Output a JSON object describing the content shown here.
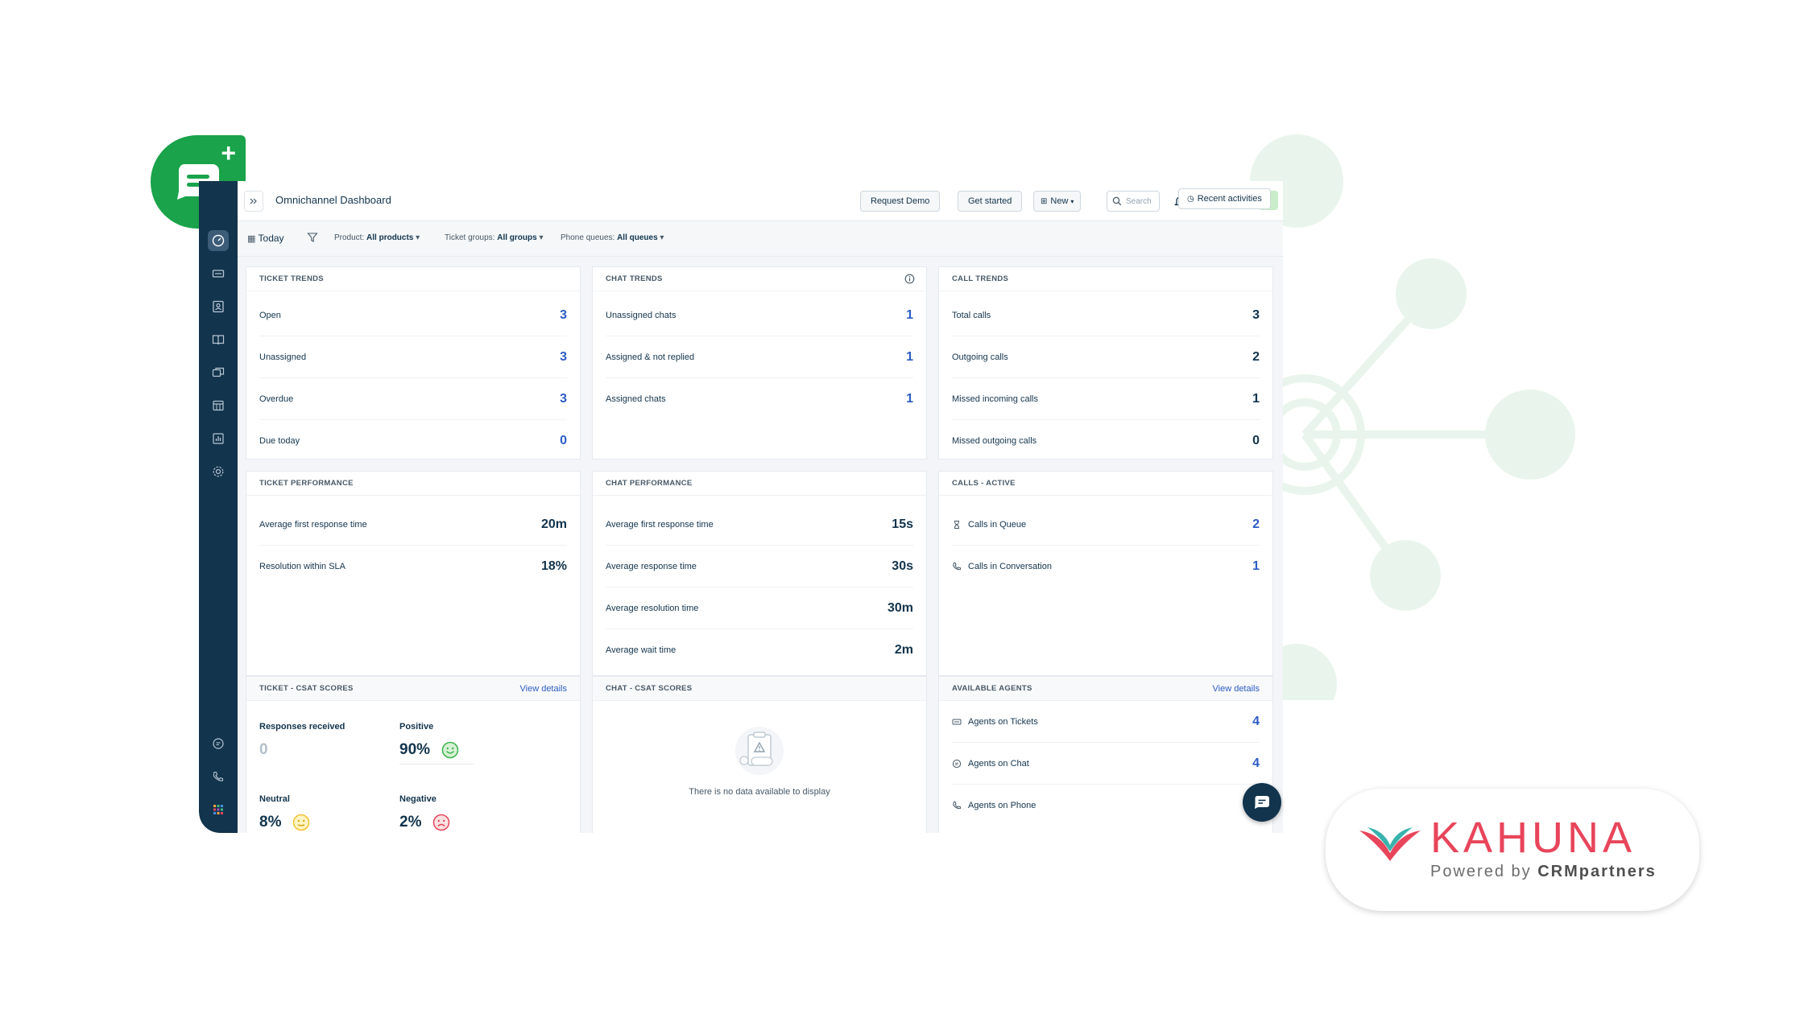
{
  "header": {
    "title": "Omnichannel Dashboard",
    "request_demo": "Request Demo",
    "get_started": "Get started",
    "new": "New",
    "search_placeholder": "Search",
    "avatar_initial": "N"
  },
  "filters": {
    "today": "Today",
    "product_label": "Product:",
    "product_value": "All products",
    "ticket_groups_label": "Ticket groups:",
    "ticket_groups_value": "All groups",
    "phone_queues_label": "Phone queues:",
    "phone_queues_value": "All queues",
    "recent_activities": "Recent activities"
  },
  "ticket_trends": {
    "title": "TICKET TRENDS",
    "rows": [
      {
        "label": "Open",
        "value": "3"
      },
      {
        "label": "Unassigned",
        "value": "3"
      },
      {
        "label": "Overdue",
        "value": "3"
      },
      {
        "label": "Due today",
        "value": "0"
      }
    ]
  },
  "chat_trends": {
    "title": "CHAT TRENDS",
    "rows": [
      {
        "label": "Unassigned chats",
        "value": "1"
      },
      {
        "label": "Assigned & not replied",
        "value": "1"
      },
      {
        "label": "Assigned chats",
        "value": "1"
      }
    ]
  },
  "call_trends": {
    "title": "CALL TRENDS",
    "rows": [
      {
        "label": "Total calls",
        "value": "3"
      },
      {
        "label": "Outgoing calls",
        "value": "2"
      },
      {
        "label": "Missed incoming calls",
        "value": "1"
      },
      {
        "label": "Missed outgoing calls",
        "value": "0"
      }
    ]
  },
  "ticket_performance": {
    "title": "TICKET PERFORMANCE",
    "rows": [
      {
        "label": "Average first response time",
        "value": "20m"
      },
      {
        "label": "Resolution within SLA",
        "value": "18%"
      }
    ]
  },
  "chat_performance": {
    "title": "CHAT PERFORMANCE",
    "rows": [
      {
        "label": "Average first response time",
        "value": "15s"
      },
      {
        "label": "Average response time",
        "value": "30s"
      },
      {
        "label": "Average resolution time",
        "value": "30m"
      },
      {
        "label": "Average wait time",
        "value": "2m"
      }
    ]
  },
  "calls_active": {
    "title": "CALLS - ACTIVE",
    "rows": [
      {
        "label": "Calls in Queue",
        "value": "2",
        "icon": "hourglass-icon"
      },
      {
        "label": "Calls in Conversation",
        "value": "1",
        "icon": "phone-icon"
      }
    ]
  },
  "ticket_csat": {
    "title": "TICKET - CSAT SCORES",
    "view_details": "View details",
    "responses_label": "Responses received",
    "responses_value": "0",
    "positive_label": "Positive",
    "positive_value": "90%",
    "neutral_label": "Neutral",
    "neutral_value": "8%",
    "negative_label": "Negative",
    "negative_value": "2%"
  },
  "chat_csat": {
    "title": "CHAT - CSAT SCORES",
    "empty": "There is no data available to display"
  },
  "available_agents": {
    "title": "AVAILABLE AGENTS",
    "view_details": "View details",
    "rows": [
      {
        "label": "Agents on Tickets",
        "value": "4",
        "icon": "ticket-icon"
      },
      {
        "label": "Agents on Chat",
        "value": "4",
        "icon": "chat-icon"
      },
      {
        "label": "Agents on Phone",
        "value": "",
        "icon": "phone-icon"
      }
    ]
  },
  "branding": {
    "name": "KAHUNA",
    "powered_prefix": "Powered by",
    "powered_name": "CRMpartners"
  },
  "colors": {
    "sidebar": "#12344d",
    "accent_blue": "#2c5cc5",
    "logo_green": "#1aa34a",
    "kahuna_red": "#e8455b",
    "deco_green": "#e9f5ec"
  }
}
